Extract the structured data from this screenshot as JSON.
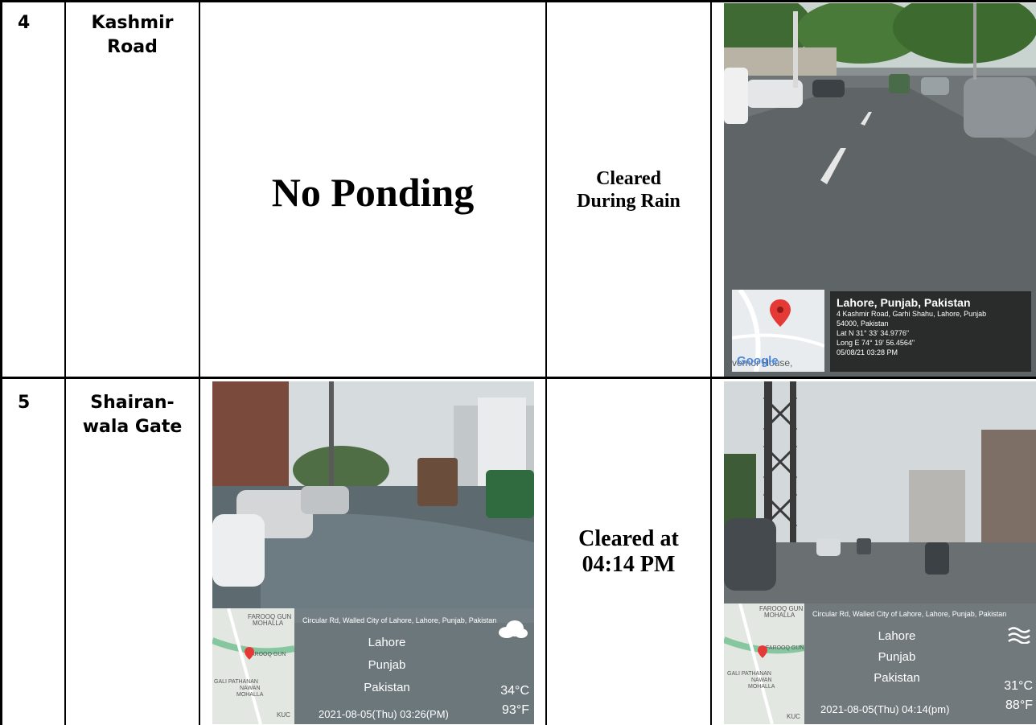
{
  "rows": [
    {
      "number": "4",
      "location": [
        "Kashmir",
        "Road"
      ],
      "before": "No Ponding",
      "status": [
        "Cleared",
        "During Rain"
      ],
      "after_photo": {
        "map_label": "Google",
        "map_extra": "vernor House,",
        "place": "Lahore, Punjab, Pakistan",
        "address1": "4 Kashmir Road, Garhi Shahu, Lahore, Punjab",
        "address2": "54000, Pakistan",
        "lat": "Lat N 31° 33' 34.9776\"",
        "long": "Long E 74° 19' 56.4564\"",
        "datetime": "05/08/21 03:28 PM"
      }
    },
    {
      "number": "5",
      "location": [
        "Shairan-",
        "wala Gate"
      ],
      "status": [
        "Cleared at",
        "04:14 PM"
      ],
      "before_photo": {
        "address": "Circular Rd, Walled City of Lahore, Lahore, Punjab, Pakistan",
        "city": "Lahore",
        "province": "Punjab",
        "country": "Pakistan",
        "temp_c": "34°C",
        "temp_f": "93°F",
        "datetime": "2021-08-05(Thu)  03:26(PM)",
        "map_labels": [
          "FAROOQ GUN",
          "MOHALLA",
          "GALI PATHANAN",
          "NAWAN",
          "MOHALLA",
          "KUC"
        ]
      },
      "after_photo": {
        "address": "Circular Rd, Walled City of Lahore, Lahore, Punjab, Pakistan",
        "city": "Lahore",
        "province": "Punjab",
        "country": "Pakistan",
        "temp_c": "31°C",
        "temp_f": "88°F",
        "datetime": "2021-08-05(Thu)  04:14(pm)",
        "map_labels": [
          "FAROOQ GUN",
          "MOHALLA",
          "GALI PATHANAN",
          "NAWAN",
          "MOHALLA",
          "KUC"
        ]
      }
    }
  ],
  "colors": {
    "border": "#000000",
    "pin": "#e53935",
    "sky": "#cfd6da",
    "road": "#6f7476",
    "water": "#5d6a70"
  }
}
